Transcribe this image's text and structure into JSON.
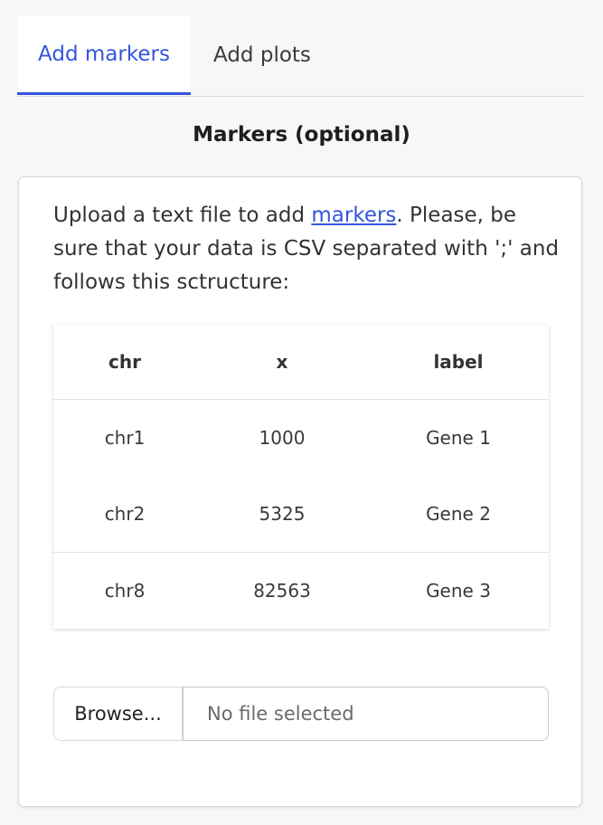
{
  "tabs": [
    {
      "label": "Add markers",
      "active": true
    },
    {
      "label": "Add plots",
      "active": false
    }
  ],
  "section": {
    "title": "Markers (optional)"
  },
  "card": {
    "description_before": "Upload a text file to add ",
    "description_link": "markers",
    "description_after": ". Please, be sure that your data is CSV separated with ';' and follows this sctructure:",
    "table": {
      "headers": [
        "chr",
        "x",
        "label"
      ],
      "rows": [
        [
          "chr1",
          "1000",
          "Gene 1"
        ],
        [
          "chr2",
          "5325",
          "Gene 2"
        ],
        [
          "chr8",
          "82563",
          "Gene 3"
        ]
      ]
    },
    "file_input": {
      "button_label": "Browse...",
      "placeholder": "No file selected"
    }
  },
  "colors": {
    "accent": "#3355dd",
    "background": "#f7f7f8",
    "card": "#ffffff"
  }
}
